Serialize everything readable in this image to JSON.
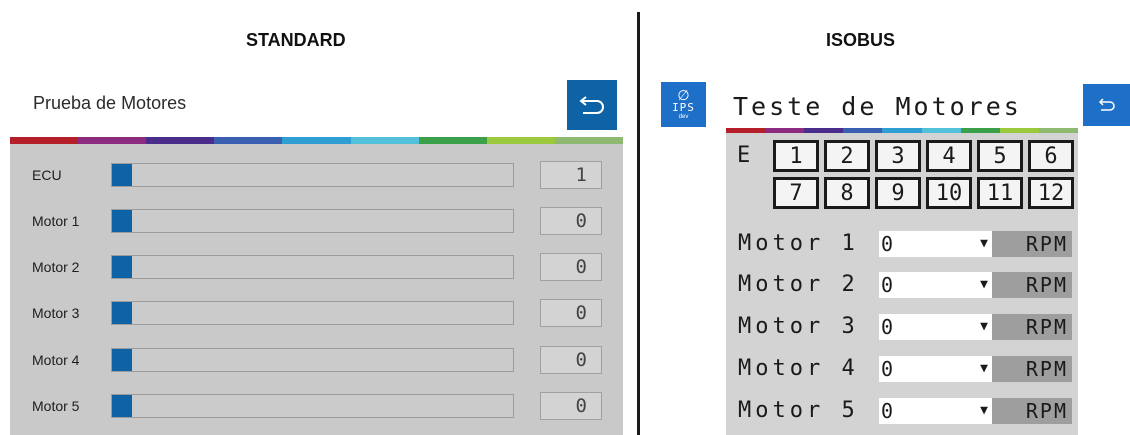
{
  "standard": {
    "section_title": "STANDARD",
    "header_title": "Prueba de Motores",
    "back_icon": "back-arrow-icon",
    "accent": "#0e63a6",
    "rows": [
      {
        "label": "ECU",
        "value": "1",
        "level": 0.05
      },
      {
        "label": "Motor 1",
        "value": "0",
        "level": 0.05
      },
      {
        "label": "Motor 2",
        "value": "0",
        "level": 0.05
      },
      {
        "label": "Motor 3",
        "value": "0",
        "level": 0.05
      },
      {
        "label": "Motor 4",
        "value": "0",
        "level": 0.05
      },
      {
        "label": "Motor 5",
        "value": "0",
        "level": 0.05
      }
    ]
  },
  "isobus": {
    "section_title": "ISOBUS",
    "header_title": "Teste de Motores",
    "logo": {
      "icon": "leaf-icon",
      "text": "IPS",
      "subtext": "dev"
    },
    "back_icon": "back-arrow-icon",
    "accent": "#1e6fc7",
    "ecu_label": "E",
    "ecu_buttons": [
      "1",
      "2",
      "3",
      "4",
      "5",
      "6",
      "7",
      "8",
      "9",
      "10",
      "11",
      "12"
    ],
    "motors": [
      {
        "label": "Motor 1",
        "value": "0",
        "unit": "RPM"
      },
      {
        "label": "Motor 2",
        "value": "0",
        "unit": "RPM"
      },
      {
        "label": "Motor 3",
        "value": "0",
        "unit": "RPM"
      },
      {
        "label": "Motor 4",
        "value": "0",
        "unit": "RPM"
      },
      {
        "label": "Motor 5",
        "value": "0",
        "unit": "RPM"
      }
    ]
  },
  "stripe_colors": [
    "#b51f2a",
    "#8b2a7e",
    "#4a2d8a",
    "#3a5fb0",
    "#2f9ed2",
    "#52c0d8",
    "#3aa04a",
    "#9bc83c",
    "#8fb870"
  ]
}
